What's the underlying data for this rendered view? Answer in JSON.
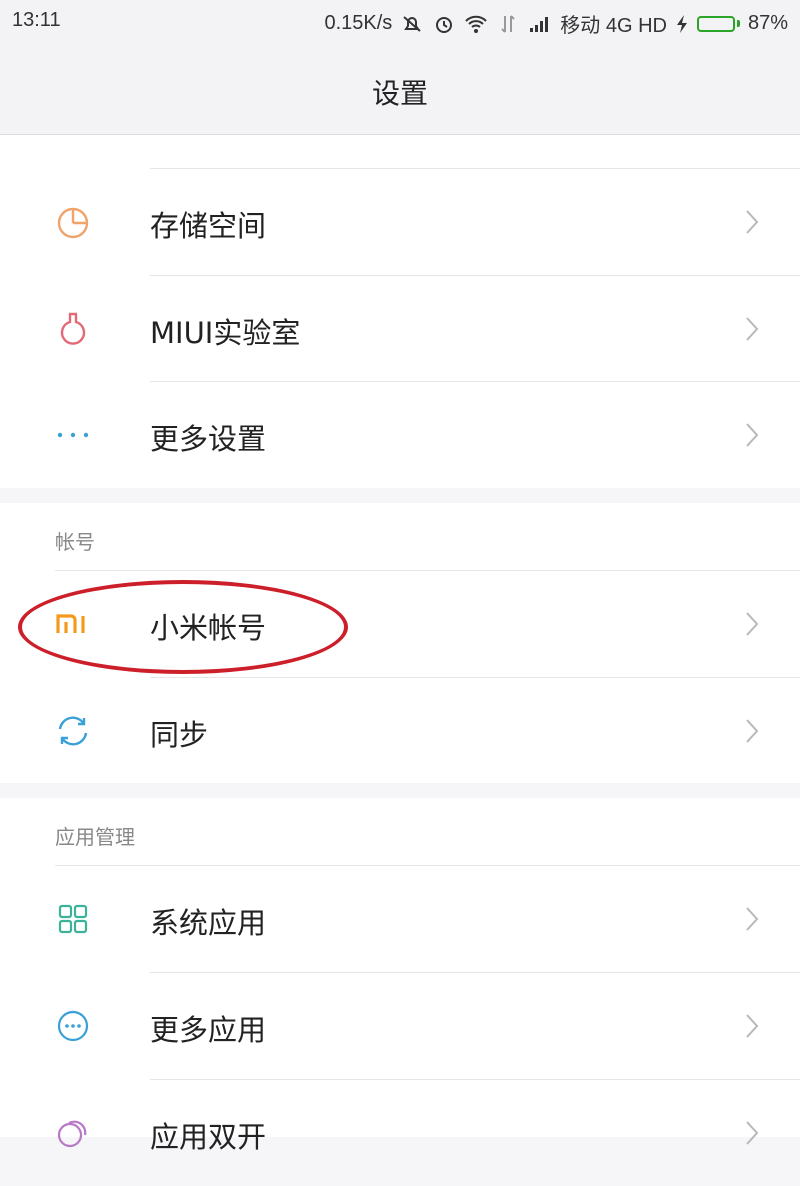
{
  "status_bar": {
    "time": "13:11",
    "net_speed": "0.15K/s",
    "carrier": "移动 4G HD",
    "battery": "87%",
    "battery_level": 0.87
  },
  "header": {
    "title": "设置"
  },
  "sections": {
    "general": {
      "items": [
        {
          "label": "存储空间",
          "icon": "pie-chart-icon",
          "color": "#f0a36a"
        },
        {
          "label": "MIUI实验室",
          "icon": "flask-icon",
          "color": "#e26a78"
        },
        {
          "label": "更多设置",
          "icon": "more-dots-icon",
          "color": "#3aa0d8"
        }
      ]
    },
    "account": {
      "heading": "帐号",
      "items": [
        {
          "label": "小米帐号",
          "icon": "mi-logo-icon",
          "color": "#f39a1e"
        },
        {
          "label": "同步",
          "icon": "sync-icon",
          "color": "#3aa0d8"
        }
      ]
    },
    "apps": {
      "heading": "应用管理",
      "items": [
        {
          "label": "系统应用",
          "icon": "grid-icon",
          "color": "#3ab39a"
        },
        {
          "label": "更多应用",
          "icon": "more-circle-icon",
          "color": "#3aa0d8"
        },
        {
          "label": "应用双开",
          "icon": "dual-app-icon",
          "color": "#b778c8"
        }
      ]
    }
  },
  "colors": {
    "annotation": "#cc1f2a",
    "chevron": "#b8b8b8",
    "background": "#f6f6f8"
  }
}
